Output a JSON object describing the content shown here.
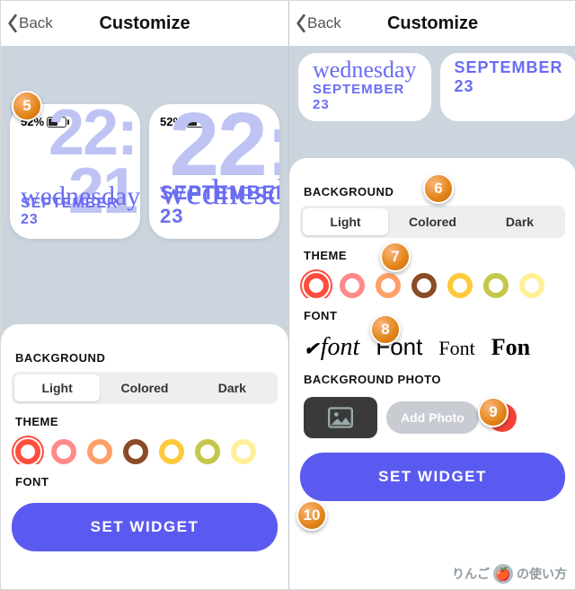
{
  "header": {
    "back": "Back",
    "title": "Customize"
  },
  "widget": {
    "battery_pct": "52%",
    "time_top": "22:",
    "time_bottom": "21",
    "day": "wednesday",
    "date": "SEPTEMBER 23"
  },
  "sections": {
    "background": "BACKGROUND",
    "theme": "THEME",
    "font": "FONT",
    "bg_photo": "BACKGROUND PHOTO"
  },
  "background_options": {
    "light": "Light",
    "colored": "Colored",
    "dark": "Dark",
    "selected": "Light"
  },
  "theme_colors": [
    "#ff4d3e",
    "#ff8a8a",
    "#ff9f68",
    "#8a4b25",
    "#ffc93a",
    "#c3c84a",
    "#fff099"
  ],
  "font_options": [
    "font",
    "Font",
    "Font",
    "Fon"
  ],
  "photo": {
    "add": "Add Photo"
  },
  "set_widget": "SET WIDGET",
  "callouts": {
    "5": "5",
    "6": "6",
    "7": "7",
    "8": "8",
    "9": "9",
    "10": "10"
  },
  "watermark": "りんご の使い方"
}
